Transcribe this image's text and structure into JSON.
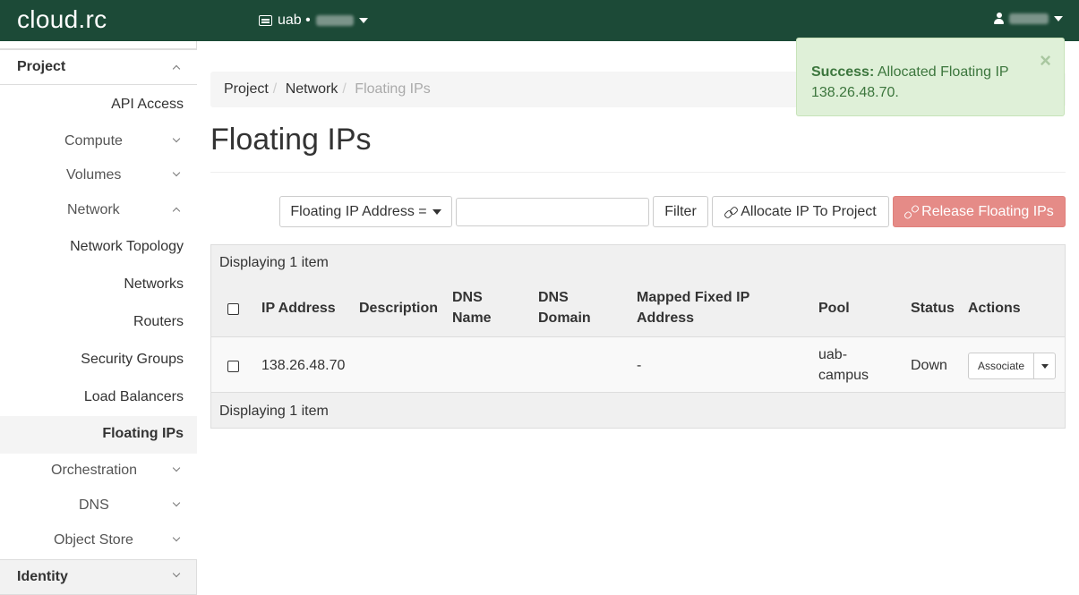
{
  "topbar": {
    "brand": "cloud.rc",
    "project_label": "uab •",
    "project_icon": "server-icon",
    "user_icon": "user-icon"
  },
  "sidebar": {
    "project_section": "Project",
    "identity_section": "Identity",
    "items": [
      {
        "label": "API Access"
      },
      {
        "label": "Compute"
      },
      {
        "label": "Volumes"
      },
      {
        "label": "Network"
      },
      {
        "label": "Orchestration"
      },
      {
        "label": "DNS"
      },
      {
        "label": "Object Store"
      }
    ],
    "network_sub": [
      {
        "label": "Network Topology"
      },
      {
        "label": "Networks"
      },
      {
        "label": "Routers"
      },
      {
        "label": "Security Groups"
      },
      {
        "label": "Load Balancers"
      },
      {
        "label": "Floating IPs"
      }
    ]
  },
  "breadcrumb": {
    "items": [
      "Project",
      "Network",
      "Floating IPs"
    ]
  },
  "page": {
    "title": "Floating IPs"
  },
  "toolbar": {
    "filter_select": "Floating IP Address =",
    "filter_value": "",
    "filter_button": "Filter",
    "allocate_button": "Allocate IP To Project",
    "release_button": "Release Floating IPs"
  },
  "table": {
    "count_text": "Displaying 1 item",
    "headers": {
      "ip": "IP Address",
      "description": "Description",
      "dns_name_1": "DNS",
      "dns_name_2": "Name",
      "dns_domain_1": "DNS",
      "dns_domain_2": "Domain",
      "mapped_1": "Mapped Fixed IP",
      "mapped_2": "Address",
      "pool": "Pool",
      "status": "Status",
      "actions": "Actions"
    },
    "rows": [
      {
        "ip": "138.26.48.70",
        "description": "",
        "dns_name": "",
        "dns_domain": "",
        "mapped": "-",
        "pool_1": "uab-",
        "pool_2": "campus",
        "status": "Down",
        "action": "Associate"
      }
    ]
  },
  "toast": {
    "title": "Success:",
    "message": "Allocated Floating IP 138.26.48.70.",
    "close": "×"
  },
  "colors": {
    "navbar": "#1c4a37",
    "success_bg": "#dff0d8",
    "success_text": "#3c763d",
    "danger": "#e58b87"
  }
}
